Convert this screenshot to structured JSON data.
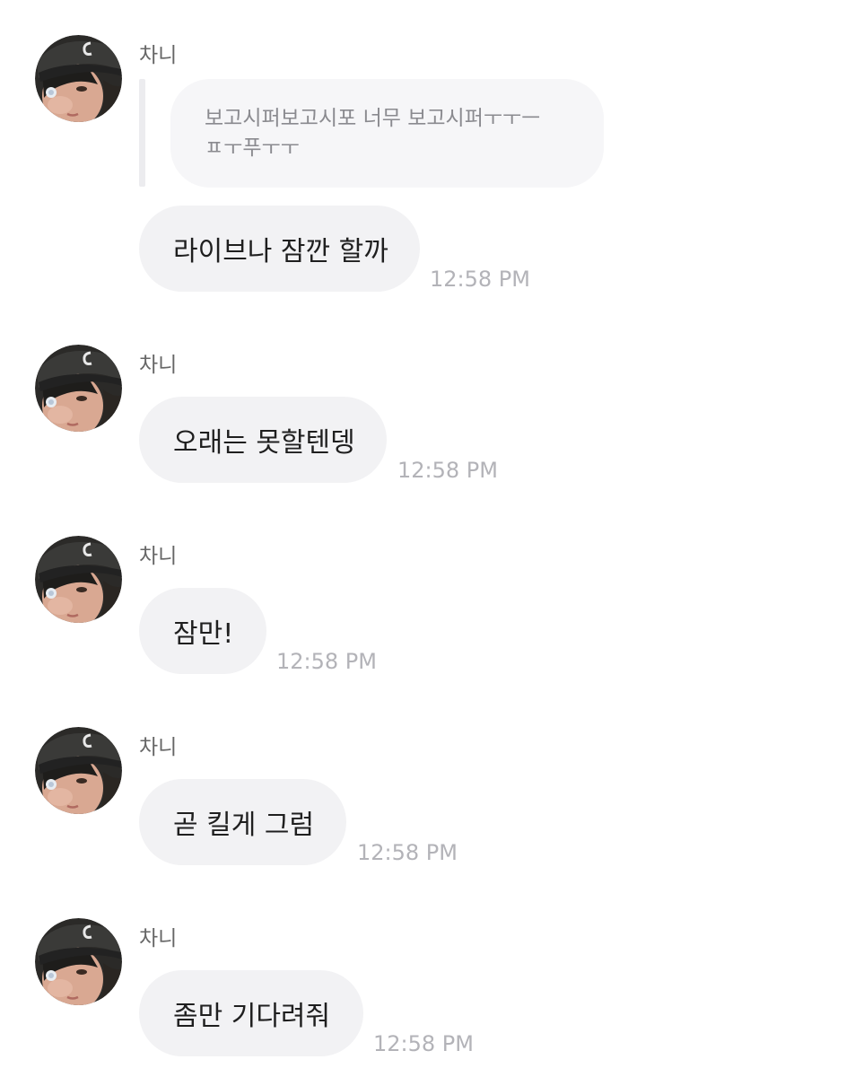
{
  "messages": [
    {
      "sender": "차니",
      "quote": "보고시퍼보고시포 너무 보고시퍼ㅜㅜㅡ\nㅍㅜ푸ㅜㅜ",
      "text": "라이브나 잠깐 할까",
      "time": "12:58 PM"
    },
    {
      "sender": "차니",
      "text": "오래는 못할텐뎅",
      "time": "12:58 PM"
    },
    {
      "sender": "차니",
      "text": "잠만!",
      "time": "12:58 PM"
    },
    {
      "sender": "차니",
      "text": "곧 킬게 그럼",
      "time": "12:58 PM"
    },
    {
      "sender": "차니",
      "text": "좀만 기다려줘",
      "time": "12:58 PM"
    }
  ],
  "icons": {
    "avatar": "profile-photo"
  },
  "colors": {
    "bubble": "#f2f2f4",
    "quote_bubble": "#f6f6f8",
    "timestamp": "#b3b3b8",
    "sender": "#666666"
  }
}
